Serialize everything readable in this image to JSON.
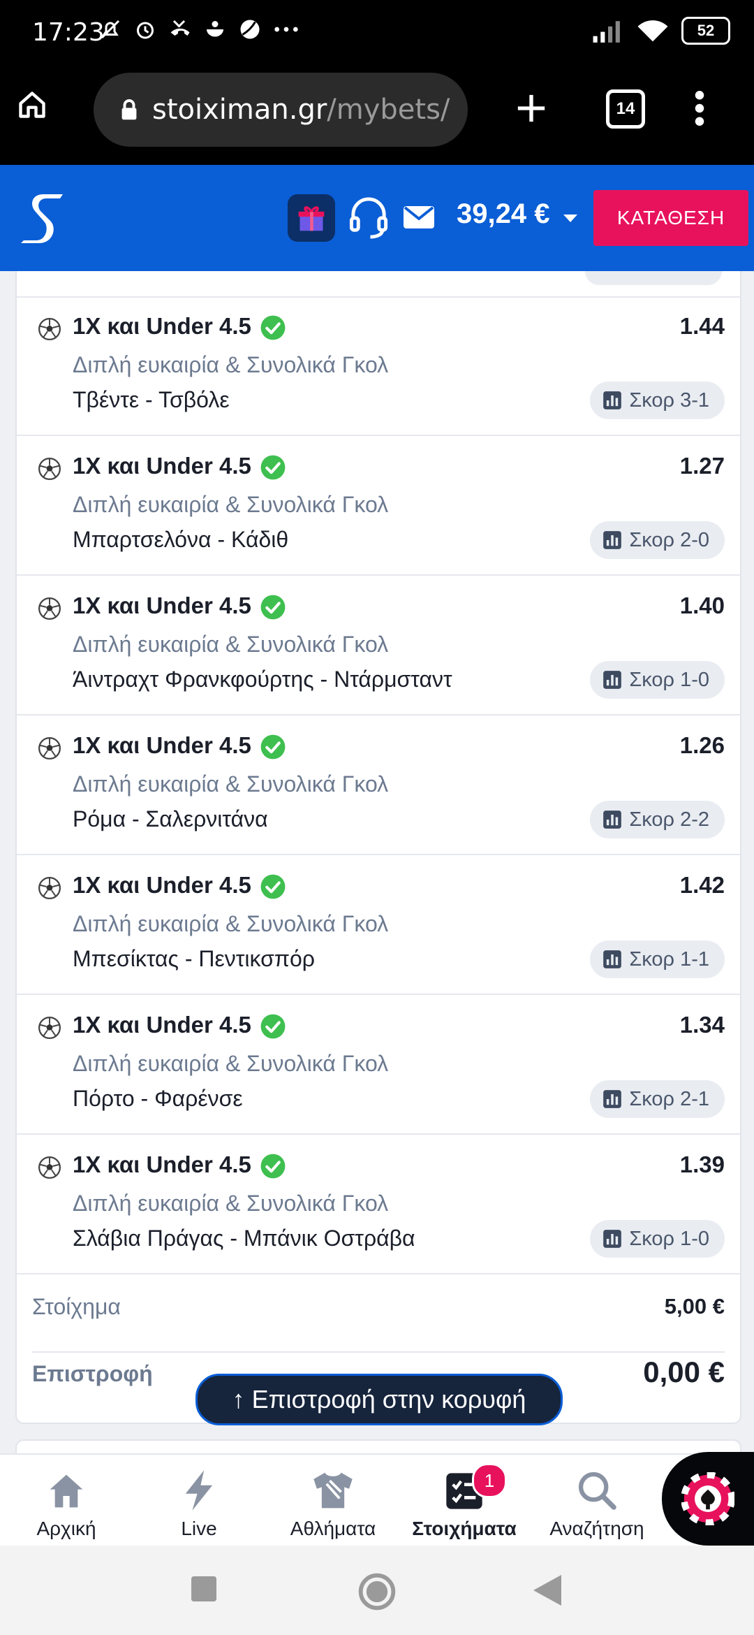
{
  "status_bar": {
    "time": "17:23",
    "battery": "52"
  },
  "browser": {
    "url_domain": "stoiximan.gr",
    "url_path": "/mybets/",
    "tab_count": "14"
  },
  "header": {
    "balance": "39,24 €",
    "deposit_label": "ΚΑΤΑΘΕΣΗ"
  },
  "bets": [
    {
      "market": "1X και Under 4.5",
      "market_type": "Διπλή ευκαιρία & Συνολικά Γκολ",
      "match": "Τβέντε - Τσβόλε",
      "odds": "1.44",
      "score": "Σκορ 3-1"
    },
    {
      "market": "1X και Under 4.5",
      "market_type": "Διπλή ευκαιρία & Συνολικά Γκολ",
      "match": "Μπαρτσελόνα - Κάδιθ",
      "odds": "1.27",
      "score": "Σκορ 2-0"
    },
    {
      "market": "1X και Under 4.5",
      "market_type": "Διπλή ευκαιρία & Συνολικά Γκολ",
      "match": "Άιντραχτ Φρανκφούρτης - Ντάρμσταντ",
      "odds": "1.40",
      "score": "Σκορ 1-0"
    },
    {
      "market": "1X και Under 4.5",
      "market_type": "Διπλή ευκαιρία & Συνολικά Γκολ",
      "match": "Ρόμα - Σαλερνιτάνα",
      "odds": "1.26",
      "score": "Σκορ 2-2"
    },
    {
      "market": "1X και Under 4.5",
      "market_type": "Διπλή ευκαιρία & Συνολικά Γκολ",
      "match": "Μπεσίκτας - Πεντικσπόρ",
      "odds": "1.42",
      "score": "Σκορ 1-1"
    },
    {
      "market": "1X και Under 4.5",
      "market_type": "Διπλή ευκαιρία & Συνολικά Γκολ",
      "match": "Πόρτο - Φαρένσε",
      "odds": "1.34",
      "score": "Σκορ 2-1"
    },
    {
      "market": "1X και Under 4.5",
      "market_type": "Διπλή ευκαιρία & Συνολικά Γκολ",
      "match": "Σλάβια Πράγας - Μπάνικ Οστράβα",
      "odds": "1.39",
      "score": "Σκορ 1-0"
    }
  ],
  "summary": {
    "stake_label": "Στοίχημα",
    "stake_value": "5,00 €",
    "return_label": "Επιστροφή",
    "return_value": "0,00 €"
  },
  "back_to_top": "↑ Επιστροφή στην κορυφή",
  "bottom_nav": [
    {
      "label": "Αρχική",
      "icon": "home-icon"
    },
    {
      "label": "Live",
      "icon": "lightning-icon"
    },
    {
      "label": "Αθλήματα",
      "icon": "jersey-icon"
    },
    {
      "label": "Στοιχήματα",
      "icon": "betslip-icon",
      "badge": "1",
      "active": true
    },
    {
      "label": "Αναζήτηση",
      "icon": "search-icon"
    }
  ],
  "colors": {
    "brand_blue": "#0a5ed6",
    "deposit_pink": "#e8125c",
    "check_green": "#3ebf4f"
  }
}
